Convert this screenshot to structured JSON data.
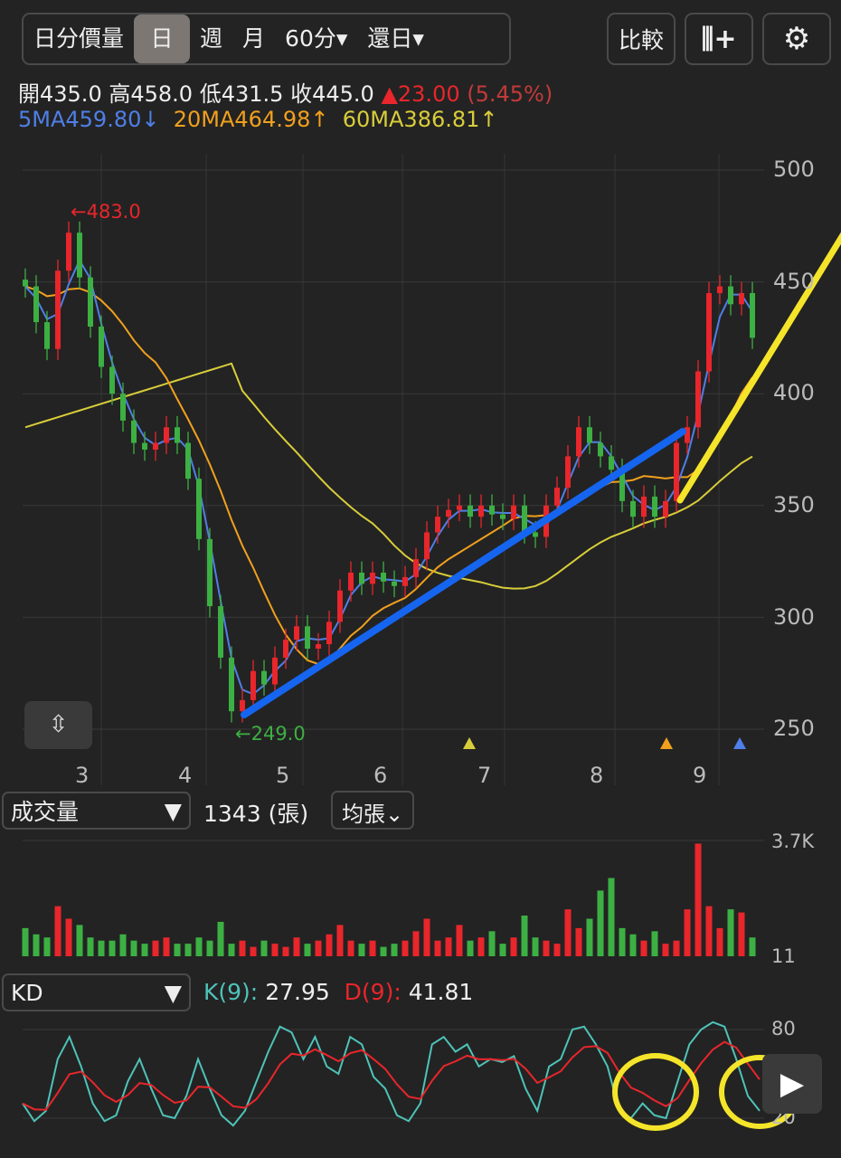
{
  "toolbar": {
    "tabs": [
      "日分價量",
      "日",
      "週",
      "月",
      "60分▾",
      "還日▾"
    ],
    "active": 1,
    "compare": "比較"
  },
  "ohlc": {
    "open_label": "開",
    "open": "435.0",
    "high_label": "高",
    "high": "458.0",
    "low_label": "低",
    "low": "431.5",
    "close_label": "收",
    "close": "445.0",
    "change": "▲23.00",
    "change_pct": "(5.45%)"
  },
  "ma": {
    "ma5": "5MA459.80↓",
    "ma20": "20MA464.98↑",
    "ma60": "60MA386.81↑"
  },
  "colors": {
    "up": "#e8262b",
    "down": "#3cb043",
    "ma5": "#4f7fe8",
    "ma20": "#f0a01e",
    "ma60": "#d8cd3a",
    "k": "#4ec3b8",
    "d": "#e8262b",
    "trend_blue": "#1565f0",
    "trend_yellow": "#f5e52a"
  },
  "annotations": {
    "high": "←483.0",
    "low": "←249.0"
  },
  "chart_data": {
    "type": "candlestick",
    "ylim": [
      250,
      500
    ],
    "y_ticks": [
      "500",
      "450",
      "400",
      "350",
      "300",
      "250"
    ],
    "x_ticks": [
      "3",
      "4",
      "5",
      "6",
      "7",
      "8",
      "9"
    ],
    "closes": [
      448,
      432,
      420,
      455,
      472,
      452,
      430,
      412,
      400,
      388,
      378,
      375,
      378,
      385,
      378,
      362,
      335,
      305,
      282,
      258,
      263,
      276,
      270,
      282,
      290,
      296,
      286,
      288,
      298,
      312,
      320,
      315,
      320,
      316,
      314,
      318,
      326,
      338,
      345,
      348,
      350,
      345,
      350,
      346,
      344,
      350,
      338,
      336,
      350,
      358,
      372,
      385,
      378,
      372,
      366,
      352,
      345,
      354,
      345,
      352,
      378,
      385,
      410,
      445,
      448,
      440,
      445,
      425
    ],
    "volume": {
      "max_label": "3.7K",
      "min_label": "11",
      "values_k": [
        0.9,
        0.7,
        0.6,
        1.6,
        1.2,
        1.0,
        0.6,
        0.5,
        0.5,
        0.7,
        0.5,
        0.4,
        0.5,
        0.6,
        0.4,
        0.4,
        0.6,
        0.5,
        1.1,
        0.4,
        0.5,
        0.3,
        0.5,
        0.4,
        0.3,
        0.6,
        0.4,
        0.5,
        0.7,
        1.0,
        0.5,
        0.4,
        0.5,
        0.3,
        0.4,
        0.5,
        0.8,
        1.2,
        0.5,
        0.6,
        1.0,
        0.5,
        0.6,
        0.8,
        0.4,
        0.6,
        1.3,
        0.6,
        0.5,
        0.4,
        1.5,
        0.9,
        1.2,
        2.1,
        2.5,
        0.9,
        0.7,
        0.5,
        0.8,
        0.4,
        0.5,
        1.5,
        3.6,
        1.6,
        0.9,
        1.5,
        1.4,
        0.6
      ]
    },
    "kd": {
      "ticks": [
        "80",
        "20"
      ],
      "k": [
        30,
        18,
        25,
        60,
        75,
        55,
        30,
        18,
        22,
        45,
        60,
        40,
        22,
        20,
        35,
        60,
        40,
        22,
        15,
        25,
        45,
        65,
        82,
        78,
        60,
        75,
        55,
        50,
        75,
        70,
        48,
        40,
        22,
        18,
        30,
        70,
        75,
        65,
        70,
        55,
        60,
        58,
        62,
        40,
        25,
        55,
        60,
        80,
        82,
        70,
        55,
        25,
        20,
        30,
        22,
        20,
        45,
        70,
        80,
        85,
        82,
        60,
        35,
        25
      ]
    }
  },
  "volume_panel": {
    "selector": "成交量",
    "value": "1343 (張)",
    "unit_btn": "均張⌄"
  },
  "kd_panel": {
    "selector": "KD",
    "k_label": "K(9):",
    "k_value": "27.95",
    "d_label": "D(9):",
    "d_value": "41.81"
  }
}
